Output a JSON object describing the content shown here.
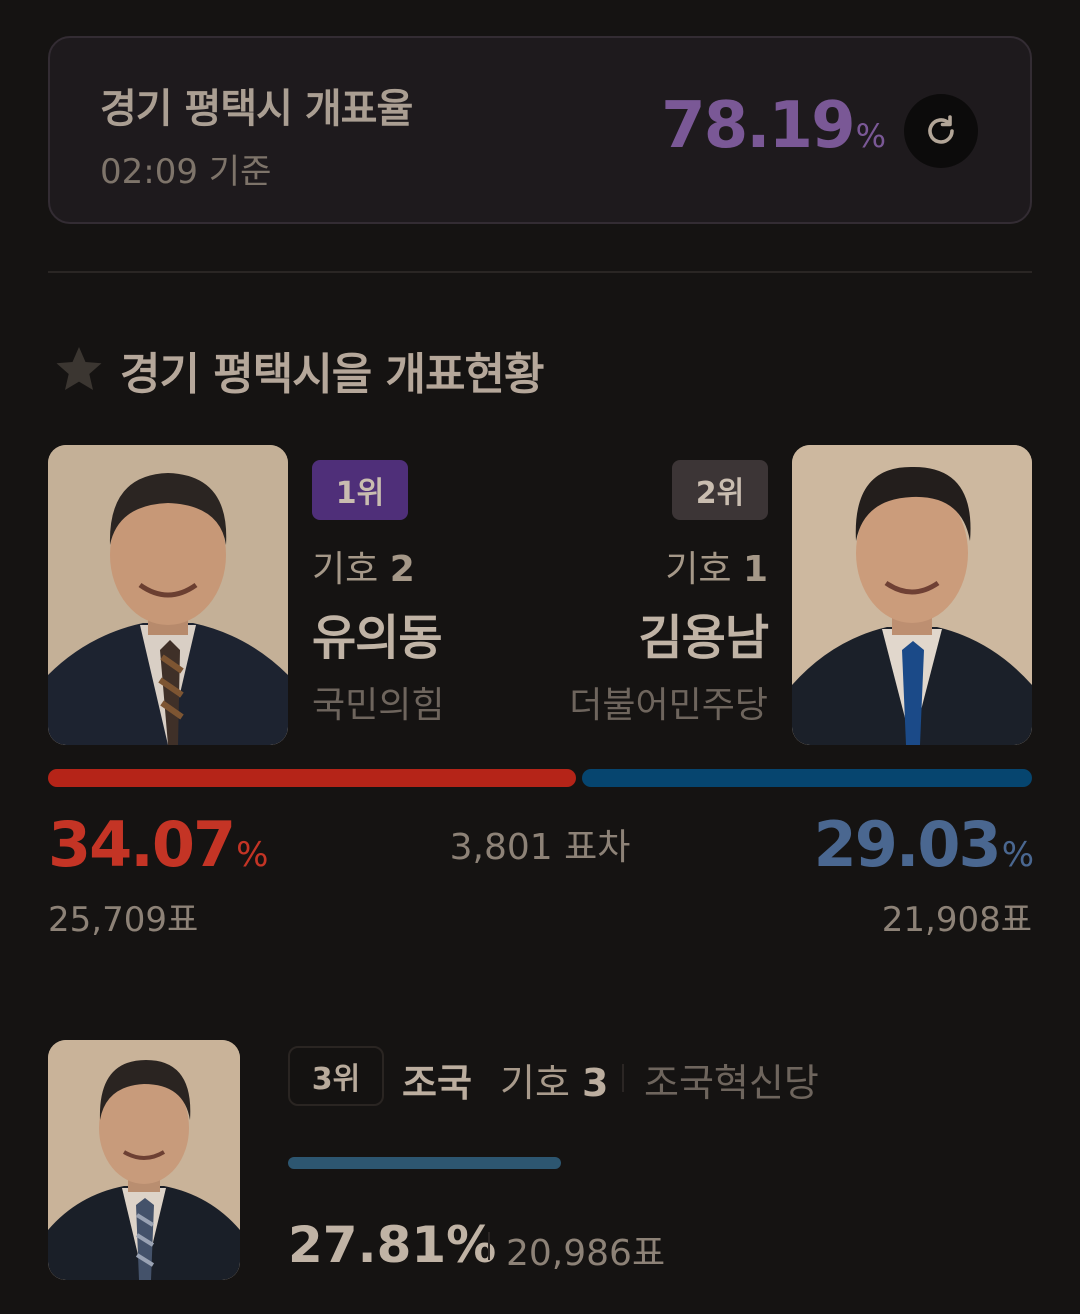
{
  "header": {
    "title": "경기 평택시 개표율",
    "time": "02:09 기준",
    "rate": "78.19",
    "rate_unit": "%",
    "refresh_icon": "refresh-icon",
    "rate_color": "#7a5896"
  },
  "section": {
    "title": "경기 평택시을 개표현황",
    "icon": "star-icon"
  },
  "candidates": [
    {
      "rank": "1위",
      "number_label": "기호",
      "number": "2",
      "name": "유의동",
      "party": "국민의힘",
      "percent": "34.07",
      "percent_unit": "%",
      "votes": "25,709표",
      "color": "#b52418",
      "share": 0.3407
    },
    {
      "rank": "2위",
      "number_label": "기호",
      "number": "1",
      "name": "김용남",
      "party": "더불어민주당",
      "percent": "29.03",
      "percent_unit": "%",
      "votes": "21,908표",
      "color": "#06456f",
      "share": 0.2903
    },
    {
      "rank": "3위",
      "name": "조국",
      "number_label": "기호",
      "number": "3",
      "party": "조국혁신당",
      "percent": "27.81%",
      "votes": "20,986표",
      "color": "#2d5670",
      "share": 0.2781
    }
  ],
  "margin": "3,801 표차"
}
